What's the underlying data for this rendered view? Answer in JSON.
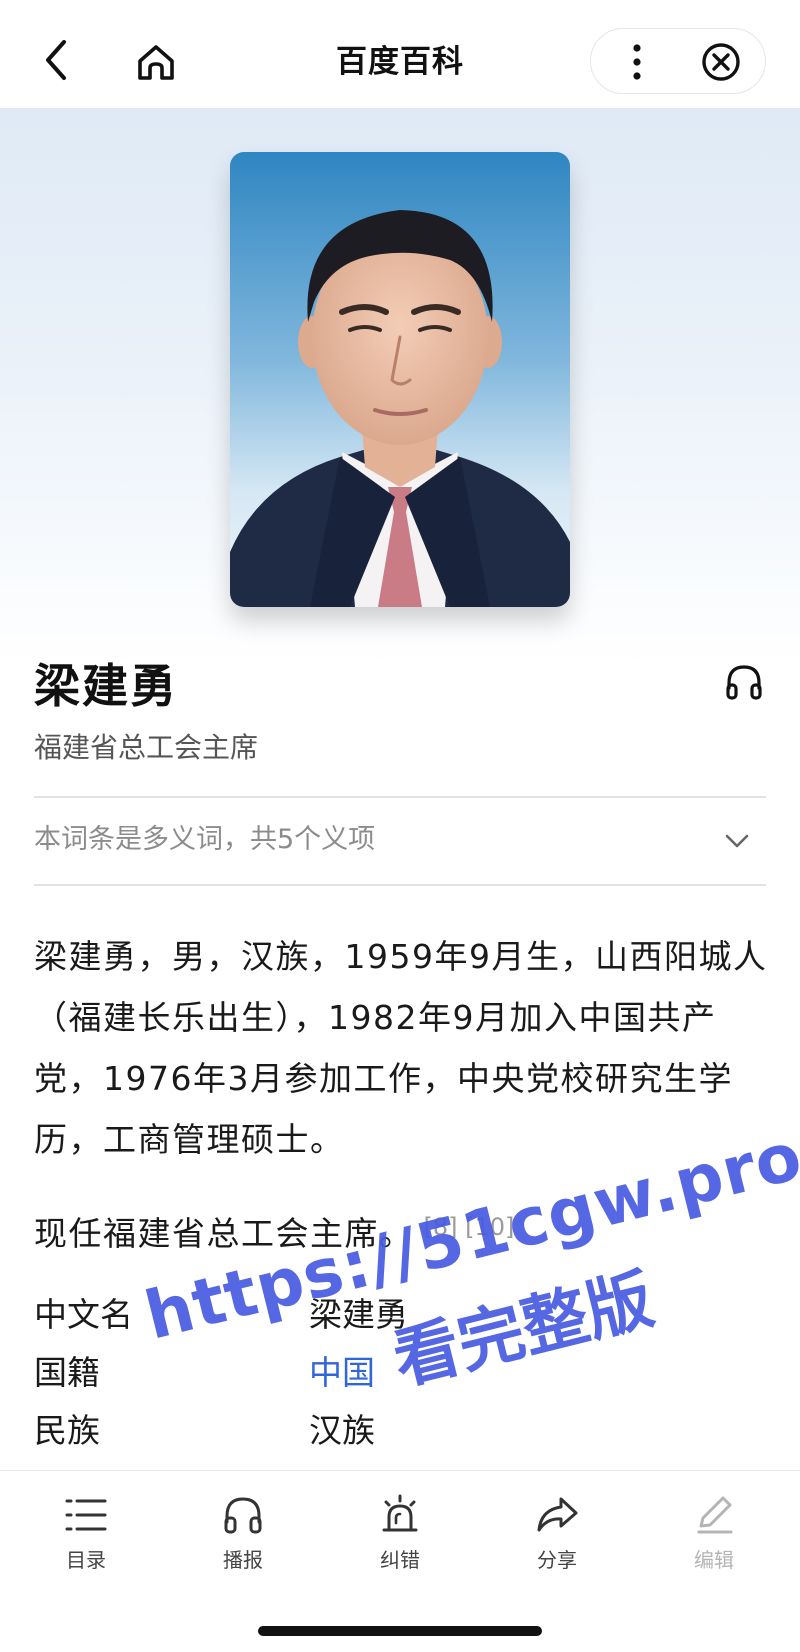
{
  "topbar": {
    "title": "百度百科",
    "icons": [
      "back-arrow-icon",
      "home-icon",
      "more-vertical-icon",
      "close-circle-icon"
    ]
  },
  "hero": {
    "portrait_icon": "portrait-photo",
    "background_top": "#dfeaf6"
  },
  "entry": {
    "name": "梁建勇",
    "subtitle": "福建省总工会主席",
    "listen_icon": "headphones-icon",
    "polysemy_text": "本词条是多义词，共5个义项"
  },
  "intro": {
    "text": "梁建勇，男，汉族，1959年9月生，山西阳城人（福建长乐出生），1982年9月加入中国共产党，1976年3月参加工作，中央党校研究生学历，工商管理硕士。"
  },
  "current": {
    "text": "现任福建省总工会主席。",
    "refs": "[8] [10]"
  },
  "infobox": {
    "rows": [
      {
        "label": "中文名",
        "value": "梁建勇"
      },
      {
        "label": "国籍",
        "value": "中国"
      },
      {
        "label": "民族",
        "value": "汉族"
      }
    ],
    "link_color": "#3066d8"
  },
  "watermark": {
    "line1": "https://51cgw.pro",
    "line2": "看完整版",
    "color": "#465ae1"
  },
  "toolbar": {
    "items": [
      {
        "label": "目录",
        "icon": "list-icon"
      },
      {
        "label": "播报",
        "icon": "headphones-icon"
      },
      {
        "label": "纠错",
        "icon": "alarm-siren-icon"
      },
      {
        "label": "分享",
        "icon": "share-arrow-icon"
      },
      {
        "label": "编辑",
        "icon": "pencil-icon"
      }
    ]
  }
}
